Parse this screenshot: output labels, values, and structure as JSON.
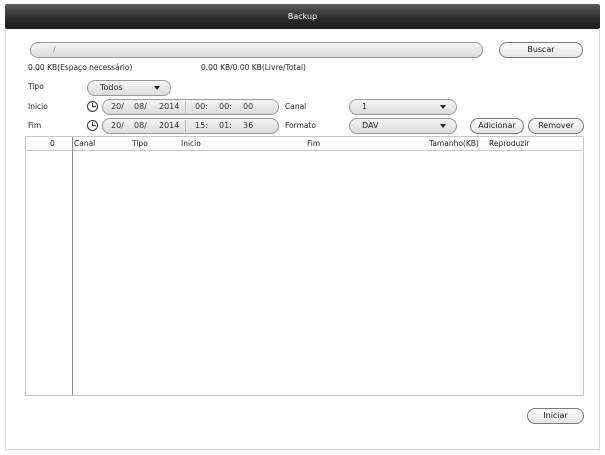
{
  "window": {
    "title": "Backup"
  },
  "path": {
    "value": "/"
  },
  "buttons": {
    "buscar": "Buscar",
    "adicionar": "Adicionar",
    "remover": "Remover",
    "iniciar": "Iniciar"
  },
  "space": {
    "required": "0.00 KB(Espaço necessário)",
    "free_total": "0.00 KB/0.00 KB(Livre/Total)"
  },
  "tipo": {
    "label": "Tipo",
    "value": "Todos"
  },
  "inicio": {
    "label": "Inicio",
    "day": "20/",
    "month": "08/",
    "year": "2014",
    "hour": "00:",
    "minute": "00:",
    "second": "00"
  },
  "fim": {
    "label": "Fim",
    "day": "20/",
    "month": "08/",
    "year": "2014",
    "hour": "15:",
    "minute": "01:",
    "second": "36"
  },
  "canal": {
    "label": "Canal",
    "value": "1"
  },
  "formato": {
    "label": "Formato",
    "value": "DAV"
  },
  "table": {
    "count": "0",
    "columns": [
      "Canal",
      "Tipo",
      "Inicio",
      "Fim",
      "Tamanho(KB)",
      "Reproduzir"
    ],
    "rows": []
  },
  "icons": {
    "clock": "clock-icon",
    "caret": "chevron-down-icon"
  }
}
